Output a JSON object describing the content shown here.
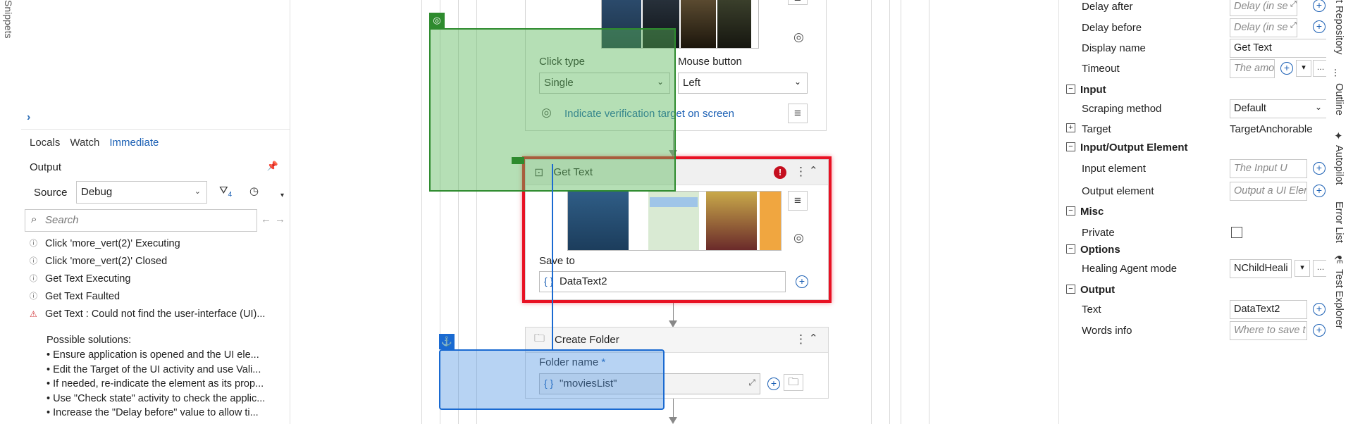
{
  "left_rail": {
    "snippets_label": "Snippets"
  },
  "left_panel": {
    "tabs": [
      "Locals",
      "Watch",
      "Immediate"
    ],
    "active_tab": "Immediate",
    "output_title": "Output",
    "source_label": "Source",
    "source_value": "Debug",
    "filter_count": "4",
    "search_placeholder": "Search",
    "log": [
      {
        "icon": "info-circle-icon",
        "text": "Click 'more_vert(2)' Executing"
      },
      {
        "icon": "info-circle-icon",
        "text": "Click 'more_vert(2)' Closed"
      },
      {
        "icon": "info-circle-icon",
        "text": "Get Text  Executing"
      },
      {
        "icon": "info-circle-icon",
        "text": "Get Text  Faulted"
      },
      {
        "icon": "warning-triangle-icon",
        "text": "Get Text : Could not find the user-interface (UI)..."
      }
    ],
    "solutions_title": "Possible solutions:",
    "solutions": [
      "•  Ensure application is opened and the UI ele...",
      "•  Edit the Target of the UI activity and use Vali...",
      "•  If needed, re-indicate the element as its prop...",
      "•  Use \"Check state\" activity to check the applic...",
      "•  Increase the \"Delay before\" value to allow ti..."
    ]
  },
  "designer": {
    "click_card": {
      "click_type_label": "Click type",
      "click_type_value": "Single",
      "mouse_button_label": "Mouse button",
      "mouse_button_value": "Left",
      "verify_link": "Indicate verification target on screen"
    },
    "get_text_card": {
      "title": "Get Text",
      "save_to_label": "Save to",
      "save_to_value": "DataText2",
      "error_badge": "!"
    },
    "create_folder_card": {
      "title": "Create Folder",
      "folder_name_label": "Folder name",
      "required_mark": "*",
      "folder_name_value": "\"moviesList\""
    }
  },
  "properties": {
    "rows_top": [
      {
        "name": "Delay after",
        "value": "Delay (in se",
        "placeholder": true
      },
      {
        "name": "Delay before",
        "value": "Delay (in se",
        "placeholder": true
      },
      {
        "name": "Display name",
        "value": "Get Text",
        "placeholder": false
      },
      {
        "name": "Timeout",
        "value": "The amo",
        "placeholder": true
      }
    ],
    "cat_input": "Input",
    "scraping_method_label": "Scraping method",
    "scraping_method_value": "Default",
    "target_label": "Target",
    "target_value": "TargetAnchorable",
    "cat_io": "Input/Output Element",
    "input_element_label": "Input element",
    "input_element_value": "The Input U",
    "output_element_label": "Output element",
    "output_element_value": "Output a UI Eler",
    "cat_misc": "Misc",
    "private_label": "Private",
    "cat_options": "Options",
    "healing_label": "Healing Agent mode",
    "healing_value": "NChildHeali",
    "cat_output": "Output",
    "text_label": "Text",
    "text_value": "DataText2",
    "words_label": "Words info",
    "words_value": "Where to save t"
  },
  "right_rail": {
    "tabs": [
      "t Repository",
      "Outline",
      "Autopilot",
      "Error List",
      "Test Explorer"
    ]
  },
  "colors": {
    "green_overlay": "#5cb85c",
    "blue_overlay": "#4a90e2",
    "red_border": "#e81123",
    "accent_blue": "#1a5fb4"
  }
}
